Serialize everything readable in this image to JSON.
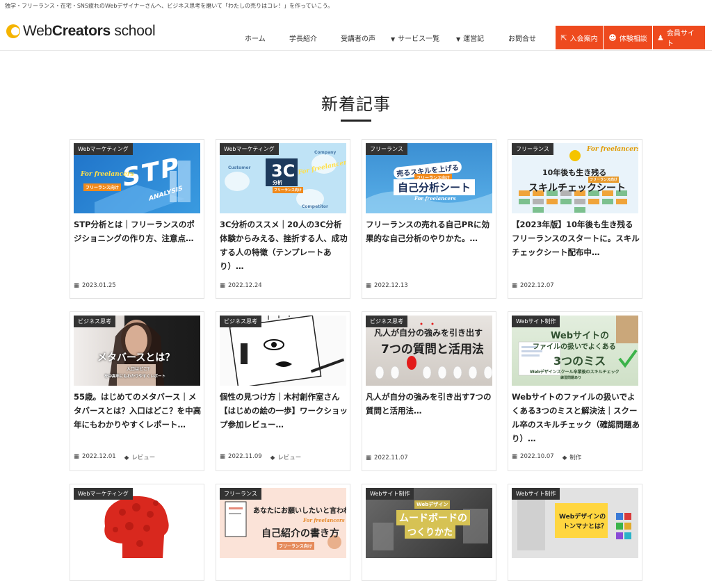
{
  "topbar": {
    "text": "独学・フリーランス・在宅・SNS疲れのWebデザイナーさんへ、ビジネス思考を磨いて「わたしの売りはコレ！」を作っていこう。"
  },
  "logo": {
    "part1": "Web",
    "part2": "Creators",
    "part3": " school"
  },
  "nav": [
    {
      "label": "ホーム"
    },
    {
      "label": "学長紹介"
    },
    {
      "label": "受講者の声"
    },
    {
      "label": "サービス一覧"
    },
    {
      "label": "運営記"
    },
    {
      "label": "お問合せ"
    }
  ],
  "buttons": [
    {
      "label": "入会案内"
    },
    {
      "label": "体験相談"
    },
    {
      "label": "会員サイト"
    }
  ],
  "section": {
    "title": "新着記事"
  },
  "cards": [
    {
      "category": "Webマーケティング",
      "title": "STP分析とは｜フリーランスのポジショニングの作り方、注意点…",
      "date": "2023.01.25",
      "tag": "",
      "thumb": {
        "main": "STP",
        "sub": "ANALYSIS",
        "script": "For freelancers",
        "band": "フリーランス向け"
      }
    },
    {
      "category": "Webマーケティング",
      "title": "3C分析のススメ｜20人の3C分析体験からみえる、挫折する人、成功する人の特徴（テンプレートあり）…",
      "date": "2022.12.24",
      "tag": "",
      "thumb": {
        "main": "3C",
        "sub": "分析",
        "script": "For freelancers",
        "band": "フリーランス向け",
        "l1": "Customer",
        "l2": "Company",
        "l3": "Competitor"
      }
    },
    {
      "category": "フリーランス",
      "title": "フリーランスの売れる自己PRに効果的な自己分析のやりかた。…",
      "date": "2022.12.13",
      "tag": "",
      "thumb": {
        "l1": "売るスキルを上げる",
        "l2": "フリーランス向け",
        "main": "自己分析シート",
        "script": "For freelancers"
      }
    },
    {
      "category": "フリーランス",
      "title": "【2023年版】10年後も生き残るフリーランスのスタートに。スキルチェックシート配布中…",
      "date": "2022.12.07",
      "tag": "",
      "thumb": {
        "script": "For freelancers",
        "l1": "10年後も生き残る",
        "band": "フリーランス向け",
        "main": "スキルチェックシート"
      }
    },
    {
      "category": "ビジネス思考",
      "title": "55歳。はじめてのメタバース｜メタバースとは？入口はどこ？を中高年にもわかりやすくレポート…",
      "date": "2022.12.01",
      "tag": "レビュー",
      "thumb": {
        "main": "メタバースとは？",
        "l1": "入口はどこ？",
        "l2": "を中高年にもわかりやすくレポート"
      }
    },
    {
      "category": "ビジネス思考",
      "title": "個性の見つけ方｜木村創作室さん【はじめの絵の一歩】ワークショップ参加レビュー…",
      "date": "2022.11.09",
      "tag": "レビュー",
      "thumb": {}
    },
    {
      "category": "ビジネス思考",
      "title": "凡人が自分の強みを引き出す7つの質問と活用法…",
      "date": "2022.11.07",
      "tag": "",
      "thumb": {
        "l1": "凡人が自分の強みを引き出す",
        "main": "7つの質問と活用法"
      }
    },
    {
      "category": "Webサイト制作",
      "title": "Webサイトのファイルの扱いでよくある3つのミスと解決法｜スクール卒のスキルチェック（確認問題あり）…",
      "date": "2022.10.07",
      "tag": "制作",
      "thumb": {
        "l1": "Webサイトの",
        "l2": "ファイルの扱いでよくある",
        "main": "3つのミス",
        "l3": "Webデザインスクール卒業後のスキルチェック",
        "l4": "練習問題あり"
      }
    },
    {
      "category": "Webマーケティング",
      "title": "",
      "date": "",
      "tag": "",
      "thumb": {}
    },
    {
      "category": "フリーランス",
      "title": "",
      "date": "",
      "tag": "",
      "thumb": {
        "l1": "あなたにお願いしたいと言われる",
        "main": "自己紹介の書き方",
        "script": "For freelancers",
        "band": "フリーランス向け"
      }
    },
    {
      "category": "Webサイト制作",
      "title": "",
      "date": "",
      "tag": "",
      "thumb": {
        "l1": "Webデザイン",
        "main": "ムードボードの",
        "l2": "つくりかた"
      }
    },
    {
      "category": "Webサイト制作",
      "title": "",
      "date": "",
      "tag": "",
      "thumb": {
        "l1": "Webデザインの",
        "l2": "トンマナとは？"
      }
    }
  ],
  "colors": {
    "accent": "#ee4a1e",
    "logo": "#f5b400",
    "badge": "#333333"
  }
}
